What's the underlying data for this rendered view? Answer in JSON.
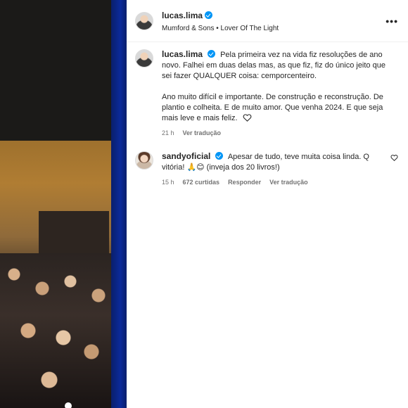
{
  "header": {
    "username": "lucas.lima",
    "subtitle": "Mumford & Sons • Lover Of The Light",
    "more_icon": "more-horizontal-icon"
  },
  "caption": {
    "username": "lucas.lima",
    "text_p1": "Pela primeira vez na vida fiz resoluções de ano novo. Falhei em duas delas mas, as que fiz, fiz do único jeito que sei fazer QUALQUER coisa: cemporcenteiro.",
    "text_p2": "Ano muito difícil e importante. De construção e reconstrução. De plantio e colheita. E de muito amor. Que venha 2024. E que seja mais leve e mais feliz.",
    "time": "21 h",
    "translate": "Ver tradução"
  },
  "comment": {
    "username": "sandyoficial",
    "text": "Apesar de tudo, teve muita coisa linda. Q vitória! 🙏😊 (inveja dos 20 livros!)",
    "time": "15 h",
    "likes": "672 curtidas",
    "reply": "Responder",
    "translate": "Ver tradução"
  },
  "colors": {
    "verified": "#0095f6",
    "muted": "#737373"
  }
}
